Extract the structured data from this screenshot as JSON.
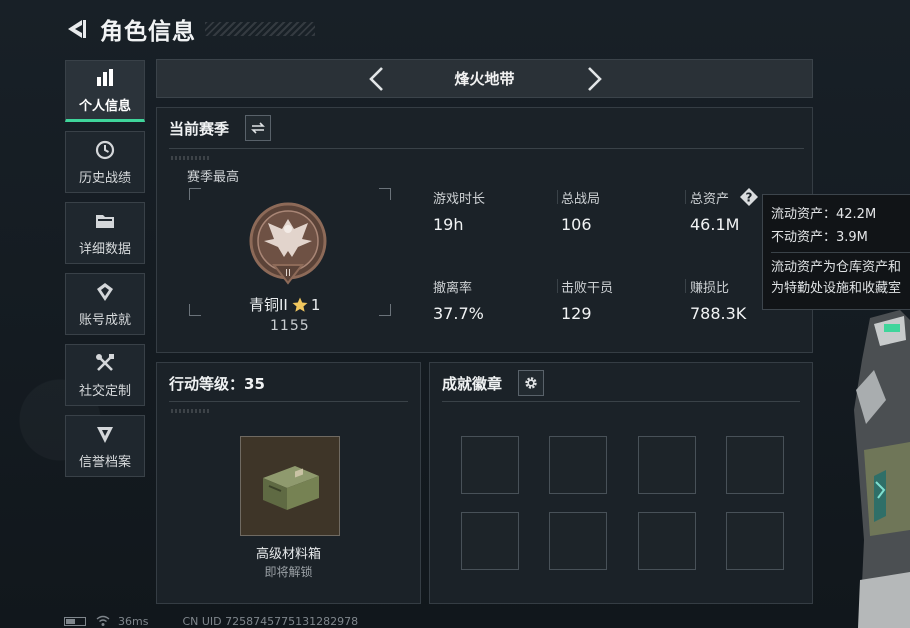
{
  "header": {
    "title": "角色信息"
  },
  "sidebar": {
    "items": [
      {
        "label": "个人信息",
        "icon": "bar-chart-icon",
        "active": true
      },
      {
        "label": "历史战绩",
        "icon": "history-icon"
      },
      {
        "label": "详细数据",
        "icon": "folder-icon"
      },
      {
        "label": "账号成就",
        "icon": "achievement-icon"
      },
      {
        "label": "社交定制",
        "icon": "tools-icon"
      },
      {
        "label": "信誉档案",
        "icon": "shield-icon"
      }
    ]
  },
  "mode_nav": {
    "title": "烽火地带"
  },
  "season": {
    "title": "当前赛季",
    "best_label": "赛季最高",
    "rank_name": "青铜II",
    "rank_stars": "1",
    "rank_score": "1155",
    "badge_numeral": "II",
    "stats": [
      {
        "label": "游戏时长",
        "value": "19h"
      },
      {
        "label": "总战局",
        "value": "106"
      },
      {
        "label": "总资产",
        "value": "46.1M"
      },
      {
        "label": "撤离率",
        "value": "37.7%"
      },
      {
        "label": "击败干员",
        "value": "129"
      },
      {
        "label": "赚损比",
        "value": "788.3K"
      }
    ]
  },
  "tooltip": {
    "liquid": "流动资产：42.2M",
    "fixed": "不动资产：3.9M",
    "desc_line1": "流动资产为仓库资产和",
    "desc_line2": "为特勤处设施和收藏室"
  },
  "level": {
    "title": "行动等级：35",
    "reward_name": "高级材料箱",
    "reward_status": "即将解锁"
  },
  "achievements": {
    "title": "成就徽章"
  },
  "footer": {
    "ping": "36ms",
    "uid": "CN UID 7258745775131282978"
  },
  "colors": {
    "accent": "#3fd59b",
    "bronze": "#8d6a58"
  }
}
